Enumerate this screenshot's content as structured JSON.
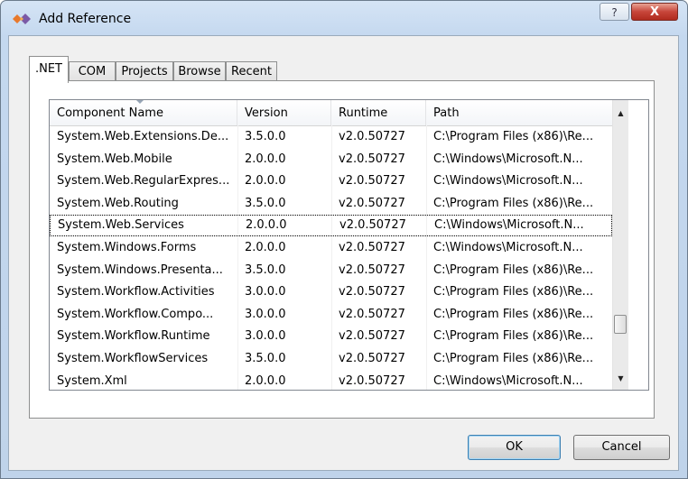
{
  "window": {
    "title": "Add Reference",
    "help_glyph": "?",
    "close_glyph": "X"
  },
  "tabs": [
    ".NET",
    "COM",
    "Projects",
    "Browse",
    "Recent"
  ],
  "active_tab": ".NET",
  "columns": [
    "Component Name",
    "Version",
    "Runtime",
    "Path"
  ],
  "rows": [
    [
      "System.Web.Extensions.De...",
      "3.5.0.0",
      "v2.0.50727",
      "C:\\Program Files (x86)\\Re..."
    ],
    [
      "System.Web.Mobile",
      "2.0.0.0",
      "v2.0.50727",
      "C:\\Windows\\Microsoft.N..."
    ],
    [
      "System.Web.RegularExpres...",
      "2.0.0.0",
      "v2.0.50727",
      "C:\\Windows\\Microsoft.N..."
    ],
    [
      "System.Web.Routing",
      "3.5.0.0",
      "v2.0.50727",
      "C:\\Program Files (x86)\\Re..."
    ],
    [
      "System.Web.Services",
      "2.0.0.0",
      "v2.0.50727",
      "C:\\Windows\\Microsoft.N..."
    ],
    [
      "System.Windows.Forms",
      "2.0.0.0",
      "v2.0.50727",
      "C:\\Windows\\Microsoft.N..."
    ],
    [
      "System.Windows.Presenta...",
      "3.5.0.0",
      "v2.0.50727",
      "C:\\Program Files (x86)\\Re..."
    ],
    [
      "System.Workflow.Activities",
      "3.0.0.0",
      "v2.0.50727",
      "C:\\Program Files (x86)\\Re..."
    ],
    [
      "System.Workflow.Compo...",
      "3.0.0.0",
      "v2.0.50727",
      "C:\\Program Files (x86)\\Re..."
    ],
    [
      "System.Workflow.Runtime",
      "3.0.0.0",
      "v2.0.50727",
      "C:\\Program Files (x86)\\Re..."
    ],
    [
      "System.WorkflowServices",
      "3.5.0.0",
      "v2.0.50727",
      "C:\\Program Files (x86)\\Re..."
    ],
    [
      "System.Xml",
      "2.0.0.0",
      "v2.0.50727",
      "C:\\Windows\\Microsoft.N..."
    ]
  ],
  "selected_row": "System.Web.Services",
  "sort_column": "Component Name",
  "buttons": {
    "ok": "OK",
    "cancel": "Cancel"
  },
  "scrollbar": {
    "up_glyph": "▲",
    "down_glyph": "▼",
    "position_fraction": 0.8
  },
  "icons": {
    "app": "visual-studio-icon",
    "help": "help-icon",
    "close": "close-icon"
  }
}
